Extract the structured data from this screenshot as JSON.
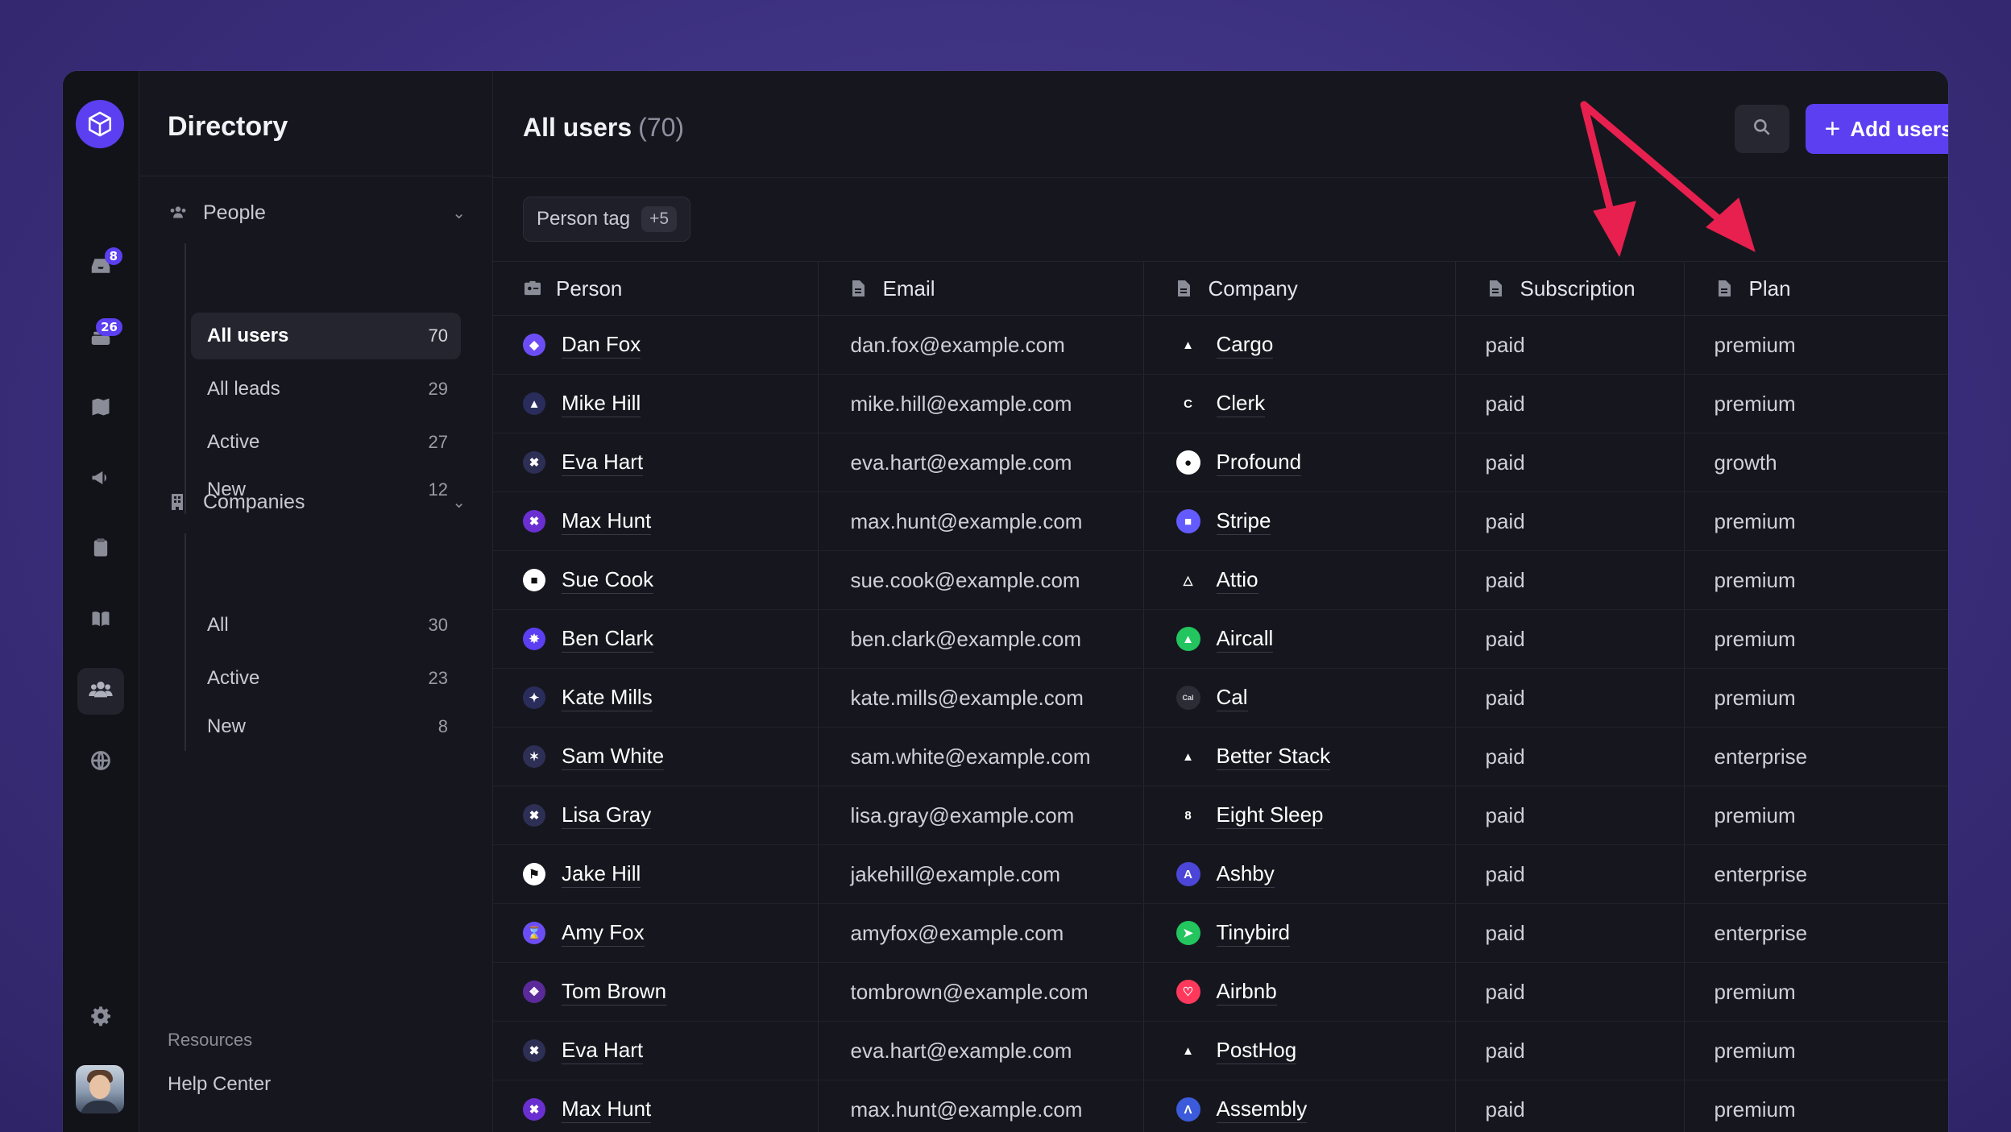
{
  "sidebar_rail": {
    "badges": {
      "inbox": "8",
      "layers": "26"
    }
  },
  "directory": {
    "title": "Directory",
    "people": {
      "label": "People",
      "items": [
        {
          "label": "All users",
          "count": "70"
        },
        {
          "label": "All leads",
          "count": "29"
        },
        {
          "label": "Active",
          "count": "27"
        },
        {
          "label": "New",
          "count": "12"
        }
      ]
    },
    "companies": {
      "label": "Companies",
      "items": [
        {
          "label": "All",
          "count": "30"
        },
        {
          "label": "Active",
          "count": "23"
        },
        {
          "label": "New",
          "count": "8"
        }
      ]
    },
    "resources_label": "Resources",
    "help_center": "Help Center"
  },
  "main": {
    "title": "All users",
    "count": "(70)",
    "add_button": "Add users",
    "filter": {
      "label": "Person tag",
      "more": "+5"
    }
  },
  "table": {
    "columns": [
      "Person",
      "Email",
      "Company",
      "Subscription",
      "Plan"
    ],
    "rows": [
      {
        "person": "Dan Fox",
        "email": "dan.fox@example.com",
        "company": "Cargo",
        "subscription": "paid",
        "plan": "premium"
      },
      {
        "person": "Mike Hill",
        "email": "mike.hill@example.com",
        "company": "Clerk",
        "subscription": "paid",
        "plan": "premium"
      },
      {
        "person": "Eva Hart",
        "email": "eva.hart@example.com",
        "company": "Profound",
        "subscription": "paid",
        "plan": "growth"
      },
      {
        "person": "Max Hunt",
        "email": "max.hunt@example.com",
        "company": "Stripe",
        "subscription": "paid",
        "plan": "premium"
      },
      {
        "person": "Sue Cook",
        "email": "sue.cook@example.com",
        "company": "Attio",
        "subscription": "paid",
        "plan": "premium"
      },
      {
        "person": "Ben Clark",
        "email": "ben.clark@example.com",
        "company": "Aircall",
        "subscription": "paid",
        "plan": "premium"
      },
      {
        "person": "Kate Mills",
        "email": "kate.mills@example.com",
        "company": "Cal",
        "subscription": "paid",
        "plan": "premium"
      },
      {
        "person": "Sam White",
        "email": "sam.white@example.com",
        "company": "Better Stack",
        "subscription": "paid",
        "plan": "enterprise"
      },
      {
        "person": "Lisa Gray",
        "email": "lisa.gray@example.com",
        "company": "Eight Sleep",
        "subscription": "paid",
        "plan": "premium"
      },
      {
        "person": "Jake Hill",
        "email": "jakehill@example.com",
        "company": "Ashby",
        "subscription": "paid",
        "plan": "enterprise"
      },
      {
        "person": "Amy Fox",
        "email": "amyfox@example.com",
        "company": "Tinybird",
        "subscription": "paid",
        "plan": "enterprise"
      },
      {
        "person": "Tom Brown",
        "email": "tombrown@example.com",
        "company": "Airbnb",
        "subscription": "paid",
        "plan": "premium"
      },
      {
        "person": "Eva Hart",
        "email": "eva.hart@example.com",
        "company": "PostHog",
        "subscription": "paid",
        "plan": "premium"
      },
      {
        "person": "Max Hunt",
        "email": "max.hunt@example.com",
        "company": "Assembly",
        "subscription": "paid",
        "plan": "premium"
      }
    ]
  },
  "colors": {
    "accent": "#5b3ff0",
    "background": "#16171e",
    "annotation_arrow": "#e8204f"
  },
  "icons": {
    "rail": [
      "cube-logo-icon",
      "inbox-icon",
      "layers-icon",
      "map-icon",
      "megaphone-icon",
      "clipboard-icon",
      "book-icon",
      "users-icon",
      "globe-icon",
      "gear-icon"
    ],
    "header": [
      "search-icon",
      "plus-icon"
    ],
    "columns": [
      "id-card-icon",
      "document-icon",
      "document-icon",
      "document-icon",
      "document-icon"
    ]
  }
}
